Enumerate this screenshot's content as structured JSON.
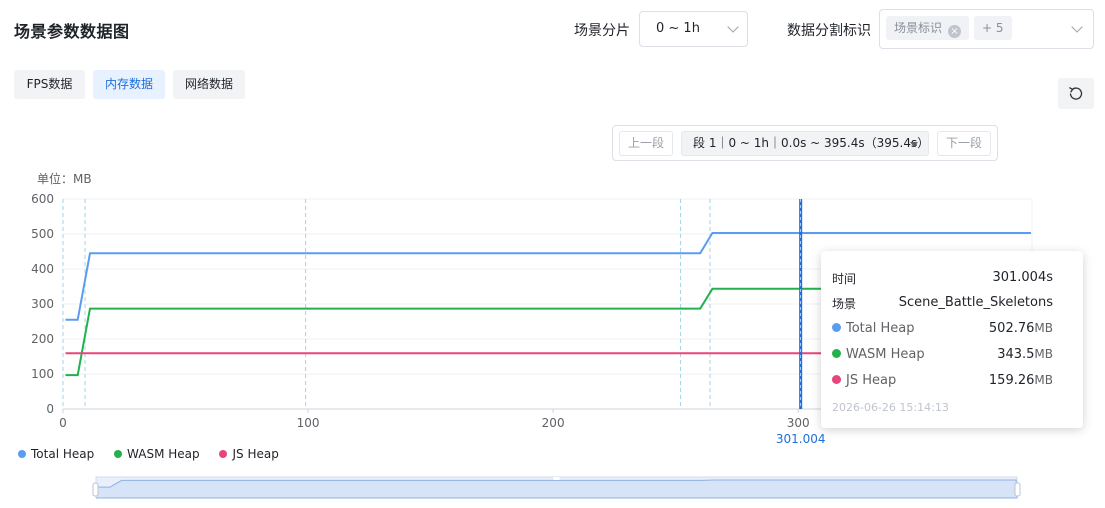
{
  "header": {
    "title": "场景参数数据图",
    "scene_slice_label": "场景分片",
    "scene_slice_value": "0 ~ 1h",
    "split_label": "数据分割标识",
    "split_tag": "场景标识",
    "split_more": "+ 5"
  },
  "tabs": [
    {
      "label": "FPS数据",
      "active": false
    },
    {
      "label": "内存数据",
      "active": true
    },
    {
      "label": "网络数据",
      "active": false
    }
  ],
  "icons": {
    "reset": "refresh-icon",
    "dropdown": "chevron-down-icon",
    "tag_close": "close-circle-icon"
  },
  "segment": {
    "prev_label": "上一段",
    "next_label": "下一段",
    "current": "段 1｜0 ~ 1h｜0.0s ~ 395.4s（395.4s）"
  },
  "unit_label": "单位：MB",
  "colors": {
    "total_heap": "#5b9bf0",
    "wasm_heap": "#22b14c",
    "js_heap": "#e8457a",
    "cursor": "#1e6fd9",
    "marker": "#9fd5e8"
  },
  "chart_data": {
    "type": "line",
    "xlabel": "",
    "ylabel": "单位：MB",
    "xlim": [
      0,
      395.4
    ],
    "ylim": [
      0,
      600
    ],
    "x_ticks": [
      0,
      100,
      200,
      300
    ],
    "y_ticks": [
      0,
      100,
      200,
      300,
      400,
      500,
      600
    ],
    "grid": true,
    "legend_position": "bottom-left",
    "series": [
      {
        "name": "Total Heap",
        "color": "#5b9bf0",
        "points": [
          [
            1,
            255
          ],
          [
            6,
            255
          ],
          [
            11,
            445
          ],
          [
            260,
            445
          ],
          [
            265,
            502.76
          ],
          [
            395,
            502.76
          ]
        ]
      },
      {
        "name": "WASM Heap",
        "color": "#22b14c",
        "points": [
          [
            1,
            97
          ],
          [
            6,
            97
          ],
          [
            11,
            287
          ],
          [
            260,
            287
          ],
          [
            265,
            343.5
          ],
          [
            395,
            343.5
          ]
        ]
      },
      {
        "name": "JS Heap",
        "color": "#e8457a",
        "points": [
          [
            1,
            159.26
          ],
          [
            395,
            159.26
          ]
        ]
      }
    ],
    "markers_x": [
      0,
      9,
      99,
      252,
      264
    ],
    "cursor_x": 301.004,
    "cursor_label": "301.004"
  },
  "tooltip": {
    "time_label": "时间",
    "time_value": "301.004s",
    "scene_label": "场景",
    "scene_value": "Scene_Battle_Skeletons",
    "rows": [
      {
        "name": "Total Heap",
        "value": "502.76",
        "unit": "MB"
      },
      {
        "name": "WASM Heap",
        "value": "343.5",
        "unit": "MB"
      },
      {
        "name": "JS Heap",
        "value": "159.26",
        "unit": "MB"
      }
    ],
    "timestamp": "2026-06-26 15:14:13"
  },
  "legend": [
    {
      "name": "Total Heap"
    },
    {
      "name": "WASM Heap"
    },
    {
      "name": "JS Heap"
    }
  ]
}
